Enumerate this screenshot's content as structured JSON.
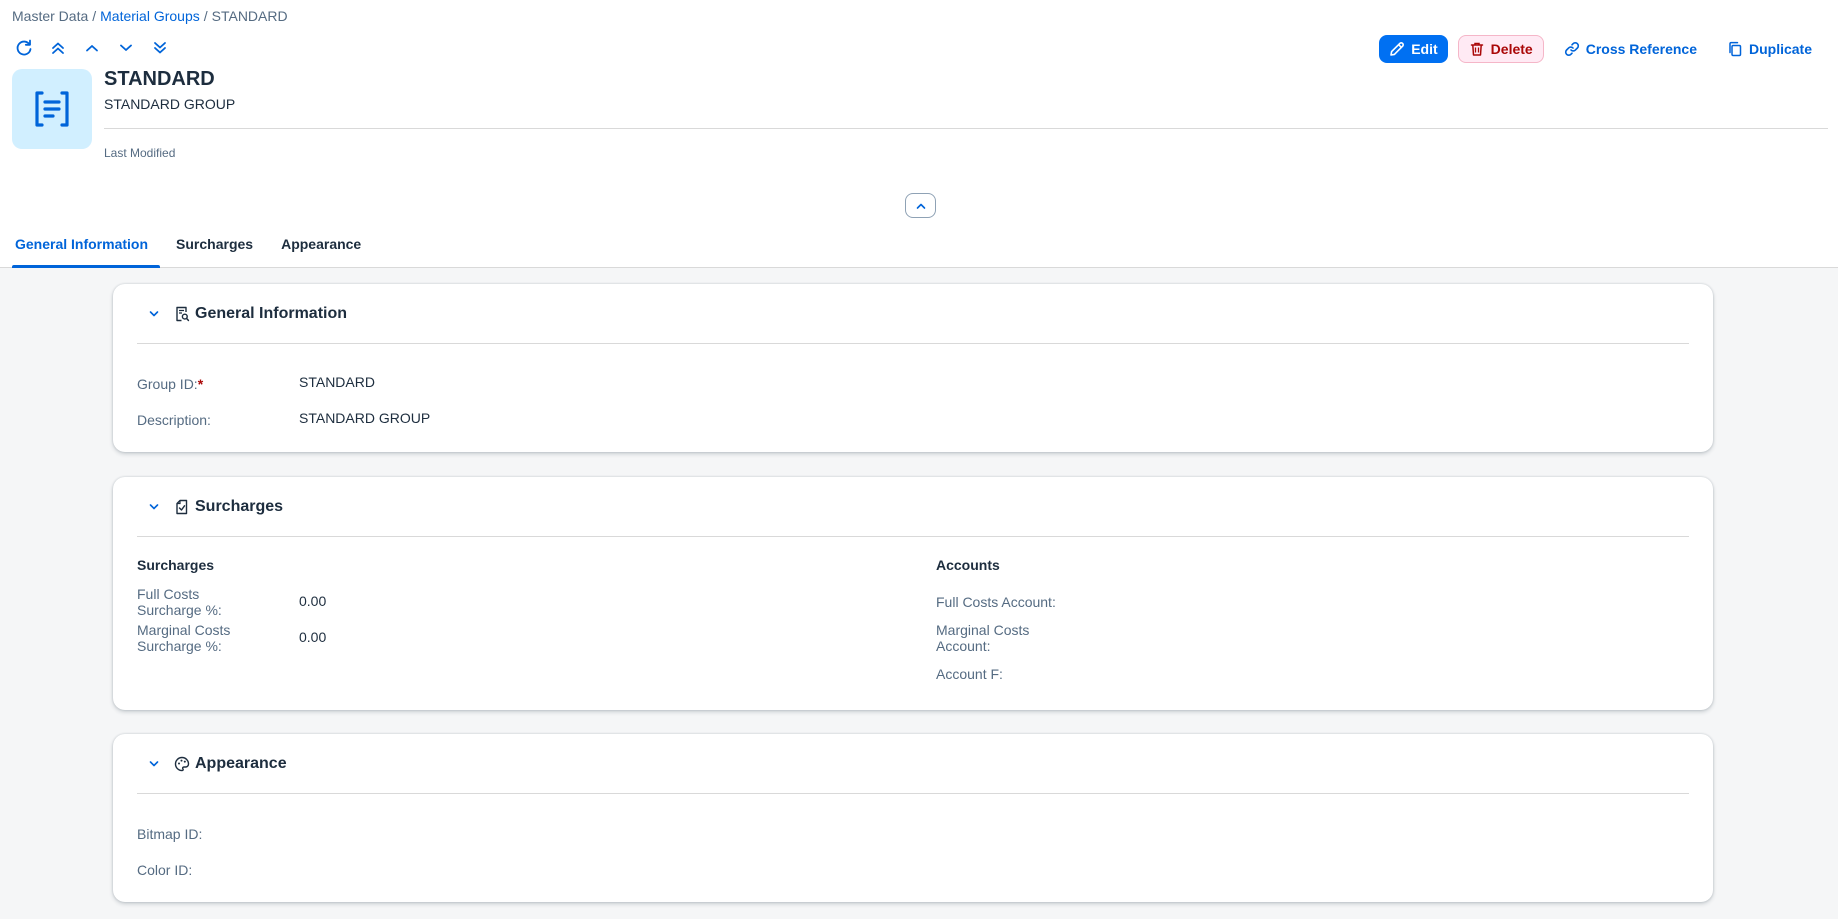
{
  "breadcrumb": {
    "root": "Master Data",
    "parent": "Material Groups",
    "current": "STANDARD",
    "separator": "/"
  },
  "actions": {
    "edit": "Edit",
    "delete": "Delete",
    "cross_reference": "Cross Reference",
    "duplicate": "Duplicate"
  },
  "object": {
    "title": "STANDARD",
    "subtitle": "STANDARD GROUP",
    "last_modified_label": "Last Modified"
  },
  "tabs": [
    {
      "label": "General Information",
      "active": true
    },
    {
      "label": "Surcharges",
      "active": false
    },
    {
      "label": "Appearance",
      "active": false
    }
  ],
  "sections": {
    "general": {
      "title": "General Information",
      "fields": {
        "group_id_label": "Group ID:",
        "group_id_required": "*",
        "group_id_value": "STANDARD",
        "description_label": "Description:",
        "description_value": "STANDARD GROUP"
      }
    },
    "surcharges": {
      "title": "Surcharges",
      "left_group_title": "Surcharges",
      "right_group_title": "Accounts",
      "full_costs_surcharge_label": "Full Costs Surcharge %:",
      "full_costs_surcharge_value": "0.00",
      "marginal_costs_surcharge_label": "Marginal Costs Surcharge %:",
      "marginal_costs_surcharge_value": "0.00",
      "full_costs_account_label": "Full Costs Account:",
      "marginal_costs_account_label": "Marginal Costs Account:",
      "account_f_label": "Account F:"
    },
    "appearance": {
      "title": "Appearance",
      "bitmap_id_label": "Bitmap ID:",
      "color_id_label": "Color ID:"
    }
  },
  "colors": {
    "accent": "#0064d9",
    "edit_button": "#0070f2",
    "delete_text": "#aa0808",
    "delete_bg": "#ffeaf4",
    "avatar_bg": "#d1efff",
    "page_bg": "#f5f6f7"
  },
  "icons": {
    "refresh": "refresh-icon",
    "first": "double-chevron-up-icon",
    "prev": "chevron-up-icon",
    "next": "chevron-down-icon",
    "last": "double-chevron-down-icon",
    "edit": "pencil-icon",
    "delete": "trash-icon",
    "cross_reference": "link-icon",
    "duplicate": "copy-icon",
    "avatar": "document-brackets-icon",
    "general": "document-search-icon",
    "surcharges": "document-check-icon",
    "appearance": "palette-icon"
  }
}
